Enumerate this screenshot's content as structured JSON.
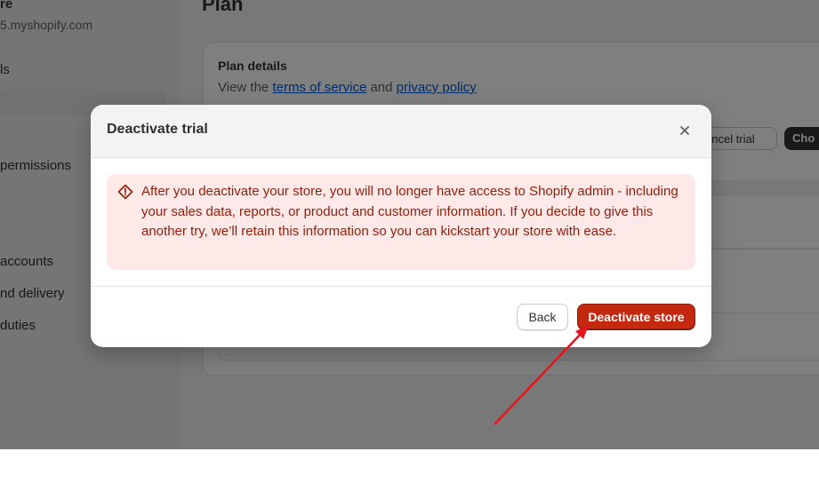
{
  "sidebar": {
    "store_name": "re",
    "store_url": "5.myshopify.com",
    "items": [
      {
        "label": "ls"
      },
      {
        "label": "permissions"
      },
      {
        "label": "accounts"
      },
      {
        "label": "nd delivery"
      },
      {
        "label": "duties"
      }
    ]
  },
  "page": {
    "title": "Plan",
    "plan_details": {
      "heading": "Plan details",
      "sub_prefix": "View the",
      "terms_link": "terms of service",
      "and": "and",
      "privacy_link": "privacy policy"
    },
    "cancel_trial_label": "ancel trial",
    "choose_label": "Cho"
  },
  "modal": {
    "title": "Deactivate trial",
    "close_icon": "close-icon",
    "banner_icon": "alert-diamond-icon",
    "banner_text": "After you deactivate your store, you will no longer have access to Shopify admin - including your sales data, reports, or product and customer information. If you decide to give this another try, we’ll retain this information so you can kickstart your store with ease.",
    "back_label": "Back",
    "deactivate_label": "Deactivate store"
  },
  "colors": {
    "critical": "#c4290f",
    "banner_bg": "#fee9e8",
    "link": "#005bd3",
    "annotation_arrow": "#e8141b"
  }
}
